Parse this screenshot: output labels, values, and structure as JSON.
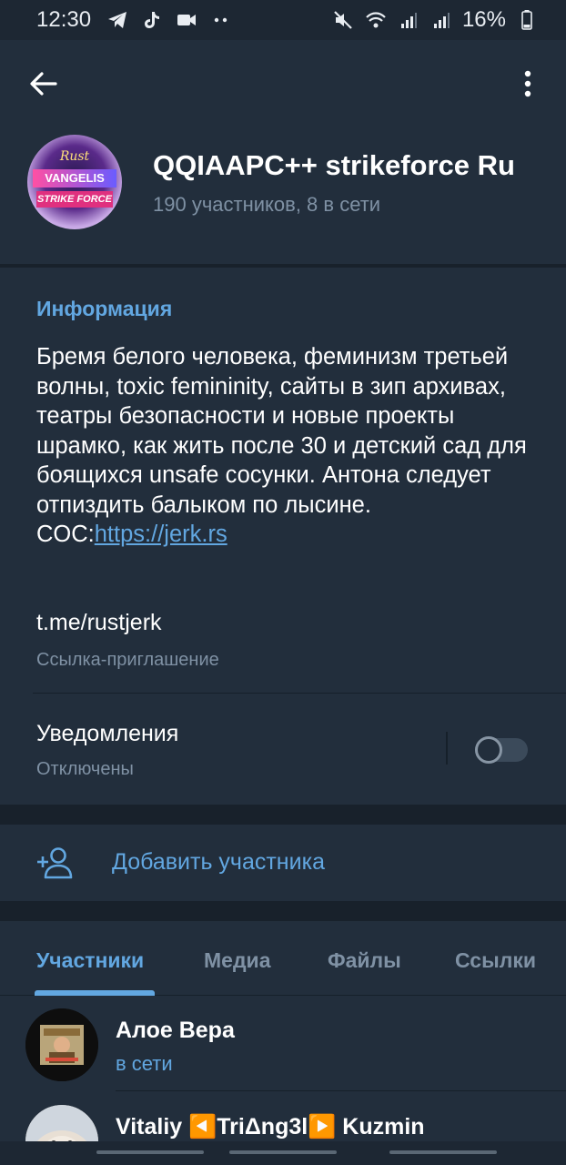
{
  "status_bar": {
    "time": "12:30",
    "left_icons": [
      "telegram-icon",
      "tiktok-icon",
      "video-icon",
      "more-dots-icon"
    ],
    "right_icons": [
      "mute-icon",
      "wifi-icon",
      "signal-icon",
      "signal-roaming-icon"
    ],
    "battery": "16%"
  },
  "header": {
    "title": "QQIAAPC++ strikeforce    Ru",
    "subtitle": "190 участников, 8 в сети",
    "avatar": {
      "line1": "Rust",
      "line2": "VANGELIS",
      "line3": "STRIKE FORCE"
    }
  },
  "info": {
    "heading": "Информация",
    "about_text": "Бремя белого человека, феминизм третьей волны, toxic femininity, сайты в зип архивах, театры безопасности и новые проекты шрамко, как жить после 30 и детский сад для боящихся unsafe сосунки. Антона следует отпиздить балыком по лысине.",
    "about_coc_prefix": "COC:",
    "about_coc_link": "https://jerk.rs",
    "invite_link": "t.me/rustjerk",
    "invite_label": "Ссылка-приглашение",
    "notifications_title": "Уведомления",
    "notifications_status": "Отключены",
    "notifications_enabled": false
  },
  "add_member": {
    "label": "Добавить участника"
  },
  "tabs": [
    {
      "label": "Участники",
      "active": true
    },
    {
      "label": "Медиа",
      "active": false
    },
    {
      "label": "Файлы",
      "active": false
    },
    {
      "label": "Ссылки",
      "active": false
    }
  ],
  "members": [
    {
      "name": "Алое Вера",
      "status": "в сети"
    },
    {
      "name": "Vitaliy ◀️TriΔng3l▶️ Kuzmin",
      "status": ""
    }
  ],
  "colors": {
    "accent": "#62a7e1",
    "background": "#1d2733",
    "card": "#222e3c",
    "muted": "#7f91a4"
  }
}
